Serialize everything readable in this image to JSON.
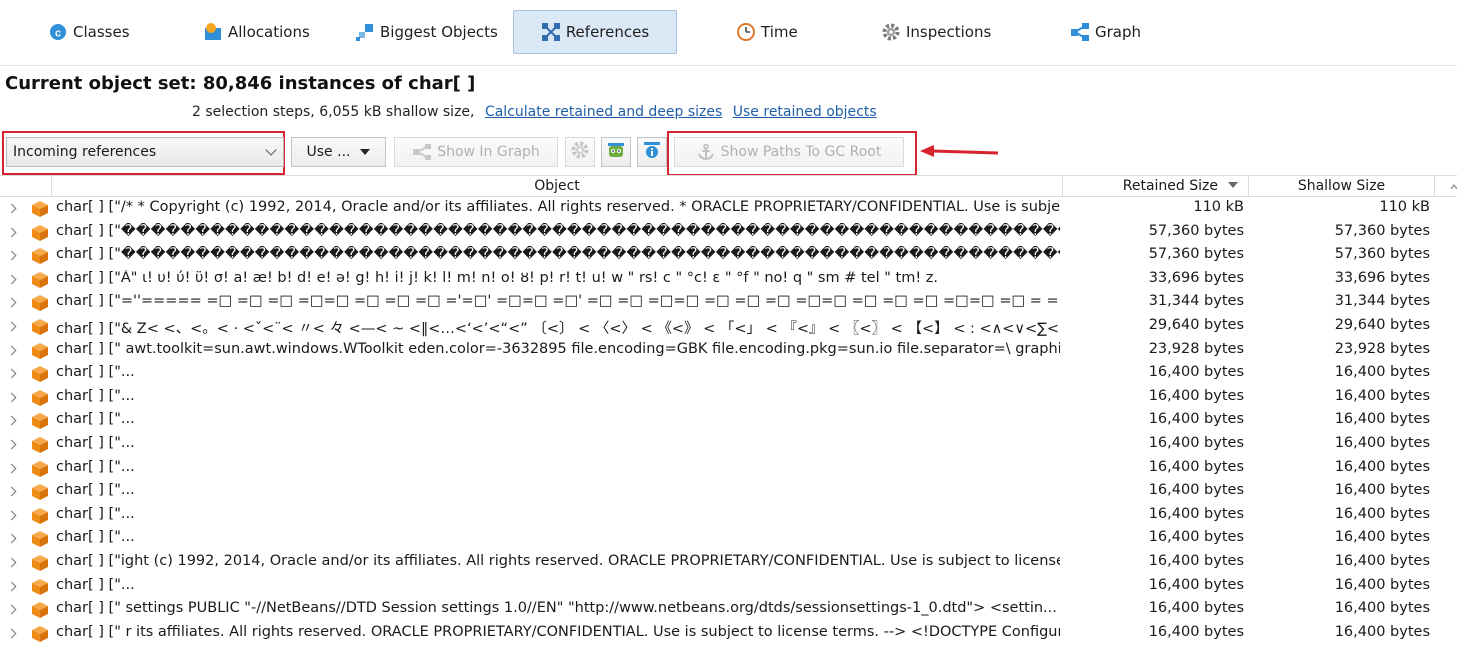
{
  "tabs": [
    {
      "label": "Classes",
      "icon": "classes-icon"
    },
    {
      "label": "Allocations",
      "icon": "allocations-icon"
    },
    {
      "label": "Biggest Objects",
      "icon": "biggest-objects-icon"
    },
    {
      "label": "References",
      "icon": "references-icon",
      "active": true
    },
    {
      "label": "Time",
      "icon": "clock-icon"
    },
    {
      "label": "Inspections",
      "icon": "gear-icon"
    },
    {
      "label": "Graph",
      "icon": "graph-icon"
    }
  ],
  "header": {
    "title": "Current object set:  80,846 instances of char[ ]",
    "steps": "2 selection steps, 6,055 kB shallow size,",
    "link_calc": "Calculate retained and deep sizes",
    "link_use": "Use retained objects"
  },
  "toolbar": {
    "combo_value": "Incoming references",
    "use_label": "Use ...",
    "show_in_graph": "Show In Graph",
    "show_paths": "Show Paths To GC Root"
  },
  "table": {
    "columns": {
      "object": "Object",
      "retained": "Retained Size",
      "shallow": "Shallow Size"
    },
    "rows": [
      {
        "object": "char[ ] [\"/*  * Copyright (c) 1992, 2014, Oracle and/or its affiliates. All rights reserved.  * ORACLE PROPRIETARY/CONFIDENTIAL. Use is subject to license terms.",
        "retained": "110 kB",
        "shallow": "110 kB"
      },
      {
        "object": "char[ ] [\"����������������������������������������������������������������������������������������",
        "retained": "57,360 bytes",
        "shallow": "57,360 bytes"
      },
      {
        "object": "char[ ] [\"����������������������������������������������������������������������������������������",
        "retained": "57,360 bytes",
        "shallow": "57,360 bytes"
      },
      {
        "object": "char[ ] [\"Ă\"  ι!  υ!  ύ!  ϋ!  σ!  a!  æ!  b!  d!  e!  ə!  g!  h!  i!  j!  k!  l!  m!  n!  o!  ȣ!  p!  r!  t!  u!  w \" rs!  c \" °c!  ε \" °f \" no!  q \" sm # tel \" tm!  z.",
        "retained": "33,696 bytes",
        "shallow": "33,696 bytes"
      },
      {
        "object": "char[ ] [\"=''===== =□ =□ =□ =□=□ =□ =□ =□ ='=□' =□=□ =□' =□ =□ =□=□ =□ =□ =□ =□=□ =□ =□ =□ =□=□ =□ = =□ =□ =□ =□ =□ =□=□ =□ =□",
        "retained": "31,344 bytes",
        "shallow": "31,344 bytes"
      },
      {
        "object": "char[ ] [\"& Z<    <、<。< · <ˇ<¨< 〃< 々 <—< ~ <‖<…<‘<’<“<” 〔<〕 < 〈<〉 < 《<》 < 「<」 < 『<』 < 〖<〗 < 【<】 < : <∧<∨<∑<∏<∪<∩<∈<…",
        "retained": "29,640 bytes",
        "shallow": "29,640 bytes"
      },
      {
        "object": "char[ ] [\" awt.toolkit=sun.awt.windows.WToolkit eden.color=-3632895 file.encoding=GBK file.encoding.pkg=sun.io file.separator=\\ graphics",
        "retained": "23,928 bytes",
        "shallow": "23,928 bytes"
      },
      {
        "object": "char[ ] [\"...",
        "retained": "16,400 bytes",
        "shallow": "16,400 bytes"
      },
      {
        "object": "char[ ] [\"...",
        "retained": "16,400 bytes",
        "shallow": "16,400 bytes"
      },
      {
        "object": "char[ ] [\"...",
        "retained": "16,400 bytes",
        "shallow": "16,400 bytes"
      },
      {
        "object": "char[ ] [\"...",
        "retained": "16,400 bytes",
        "shallow": "16,400 bytes"
      },
      {
        "object": "char[ ] [\"...",
        "retained": "16,400 bytes",
        "shallow": "16,400 bytes"
      },
      {
        "object": "char[ ] [\"...",
        "retained": "16,400 bytes",
        "shallow": "16,400 bytes"
      },
      {
        "object": "char[ ] [\"...",
        "retained": "16,400 bytes",
        "shallow": "16,400 bytes"
      },
      {
        "object": "char[ ] [\"...",
        "retained": "16,400 bytes",
        "shallow": "16,400 bytes"
      },
      {
        "object": "char[ ] [\"ight (c) 1992, 2014, Oracle and/or its affiliates. All rights reserved. ORACLE PROPRIETARY/CONFIDENTIAL. Use is subject to license terms.",
        "retained": "16,400 bytes",
        "shallow": "16,400 bytes"
      },
      {
        "object": "char[ ] [\"...",
        "retained": "16,400 bytes",
        "shallow": "16,400 bytes"
      },
      {
        "object": "char[ ] [\" settings PUBLIC \"-//NetBeans//DTD Session settings 1.0//EN\" \"http://www.netbeans.org/dtds/sessionsettings-1_0.dtd\"> <settin...",
        "retained": "16,400 bytes",
        "shallow": "16,400 bytes"
      },
      {
        "object": "char[ ] [\" r its affiliates. All rights reserved. ORACLE PROPRIETARY/CONFIDENTIAL. Use is subject to license terms. -->  <!DOCTYPE Configur...",
        "retained": "16,400 bytes",
        "shallow": "16,400 bytes"
      }
    ]
  },
  "colors": {
    "accent": "#1f5fa8",
    "highlight": "#d6232d",
    "active_tab": "#dbe8f5",
    "cube": "#f28c1c"
  }
}
